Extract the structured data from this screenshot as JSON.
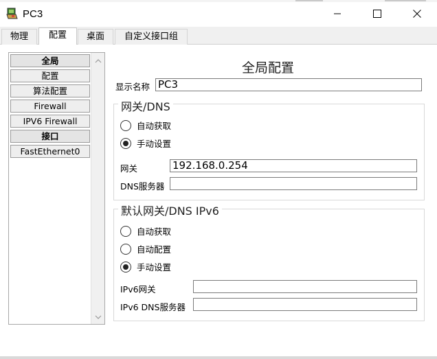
{
  "window": {
    "title": "PC3",
    "minimize_icon": "minimize-icon",
    "maximize_icon": "maximize-icon",
    "close_icon": "close-icon"
  },
  "tabs": [
    {
      "label": "物理",
      "active": false
    },
    {
      "label": "配置",
      "active": true
    },
    {
      "label": "桌面",
      "active": false
    },
    {
      "label": "自定义接口组",
      "active": false
    }
  ],
  "sidebar": {
    "items": [
      {
        "label": "全局",
        "header": true
      },
      {
        "label": "配置",
        "header": false
      },
      {
        "label": "算法配置",
        "header": false
      },
      {
        "label": "Firewall",
        "header": false
      },
      {
        "label": "IPV6 Firewall",
        "header": false
      },
      {
        "label": "接口",
        "header": true
      },
      {
        "label": "FastEthernet0",
        "header": false
      }
    ]
  },
  "main": {
    "title": "全局配置",
    "display_name_label": "显示名称",
    "display_name_value": "PC3",
    "ipv4_group": {
      "legend": "网关/DNS",
      "options": [
        {
          "label": "自动获取",
          "selected": false
        },
        {
          "label": "手动设置",
          "selected": true
        }
      ],
      "gateway_label": "网关",
      "gateway_value": "192.168.0.254",
      "dns_label": "DNS服务器",
      "dns_value": ""
    },
    "ipv6_group": {
      "legend": "默认网关/DNS IPv6",
      "options": [
        {
          "label": "自动获取",
          "selected": false
        },
        {
          "label": "自动配置",
          "selected": false
        },
        {
          "label": "手动设置",
          "selected": true
        }
      ],
      "gateway_label": "IPv6网关",
      "gateway_value": "",
      "dns_label": "IPv6 DNS服务器",
      "dns_value": ""
    }
  }
}
